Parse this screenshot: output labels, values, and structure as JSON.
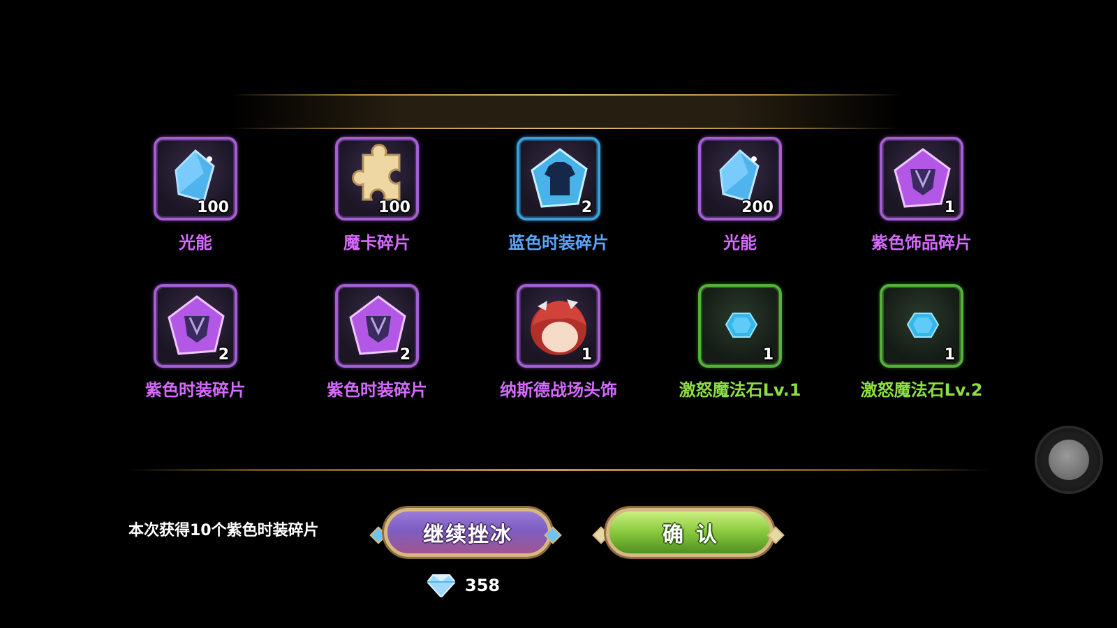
{
  "rewards": [
    {
      "name": "光能",
      "count": "100",
      "icon": "crystal-icon",
      "frame": "purple",
      "color": "#d66bff"
    },
    {
      "name": "魔卡碎片",
      "count": "100",
      "icon": "puzzle-piece-icon",
      "frame": "purple",
      "color": "#d66bff"
    },
    {
      "name": "蓝色时装碎片",
      "count": "2",
      "icon": "blue-costume-shard-icon",
      "frame": "blue",
      "color": "#5aa7ff"
    },
    {
      "name": "光能",
      "count": "200",
      "icon": "crystal-icon",
      "frame": "purple",
      "color": "#d66bff"
    },
    {
      "name": "紫色饰品碎片",
      "count": "1",
      "icon": "purple-accessory-shard-icon",
      "frame": "purple",
      "color": "#d66bff"
    },
    {
      "name": "紫色时装碎片",
      "count": "2",
      "icon": "purple-costume-shard-icon",
      "frame": "purple",
      "color": "#d66bff"
    },
    {
      "name": "紫色时装碎片",
      "count": "2",
      "icon": "purple-costume-shard-icon",
      "frame": "purple",
      "color": "#d66bff"
    },
    {
      "name": "纳斯德战场头饰",
      "count": "1",
      "icon": "red-hair-headwear-icon",
      "frame": "purple",
      "color": "#d66bff"
    },
    {
      "name": "激怒魔法石Lv.1",
      "count": "1",
      "icon": "blue-gem-icon",
      "frame": "green",
      "color": "#8de043"
    },
    {
      "name": "激怒魔法石Lv.2",
      "count": "1",
      "icon": "blue-gem-icon",
      "frame": "green",
      "color": "#8de043"
    }
  ],
  "footer": {
    "message": "本次获得10个紫色时装碎片",
    "continue_label": "继续挫冰",
    "confirm_label": "确认",
    "diamond_cost": "358",
    "diamond_icon": "diamond-icon"
  },
  "colors": {
    "purple_text": "#d66bff",
    "blue_text": "#5aa7ff",
    "green_text": "#8de043",
    "gold_trim": "#c79a55"
  }
}
